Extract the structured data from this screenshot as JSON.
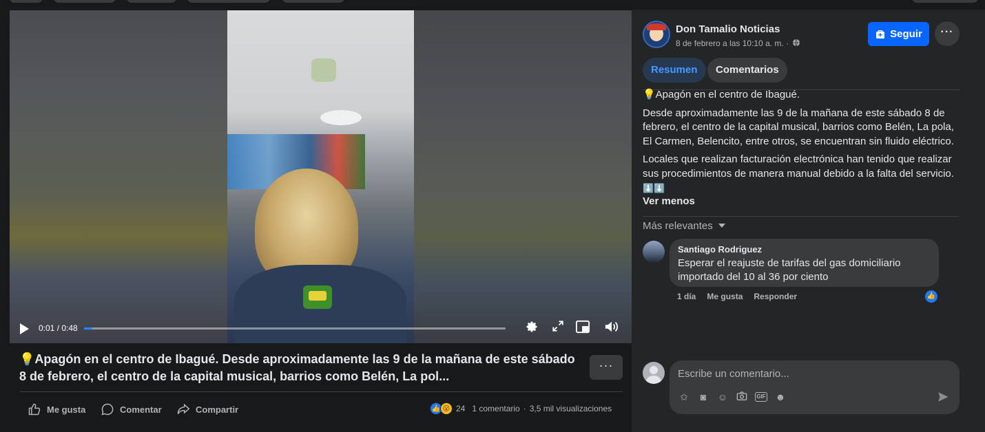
{
  "post": {
    "caption": "💡Apagón en el centro de Ibagué. Desde aproximadamente las 9 de la mañana de este sábado 8 de febrero, el centro de la capital musical, barrios como Belén, La pol...",
    "more_label": "···"
  },
  "video": {
    "time": "0:01 / 0:48",
    "progress": 0.02
  },
  "actions": {
    "like": "Me gusta",
    "comment": "Comentar",
    "share": "Compartir"
  },
  "stats": {
    "reactions": "24",
    "comments": "1 comentario",
    "separator": "·",
    "views": "3,5 mil visualizaciones"
  },
  "panel": {
    "page_name": "Don Tamalio Noticias",
    "date": "8 de febrero a las 10:10 a. m. ·",
    "follow": "Seguir",
    "tabs": [
      "Resumen",
      "Comentarios"
    ],
    "text_title": "💡Apagón en el centro de Ibagué.",
    "text_p1": "Desde aproximadamente las 9 de la mañana de este sábado 8 de febrero, el centro de la capital musical, barrios como Belén, La pola, El Carmen, Belencito, entre otros, se encuentran sin fluido eléctrico.",
    "text_p2": "Locales que realizan facturación electrónica han tenido que realizar sus procedimientos de manera manual debido a la falta del servicio.",
    "text_p3": "⬇️⬇️",
    "see_less": "Ver menos",
    "sort": "Más relevantes"
  },
  "comment": {
    "author": "Santiago Rodriguez",
    "text": "Esperar el reajuste de tarifas del gas domiciliario importado del 10 al 36 por ciento",
    "time": "1 día",
    "like": "Me gusta",
    "reply": "Responder"
  },
  "composer": {
    "placeholder": "Escribe un comentario..."
  },
  "colors": {
    "accent": "#0866ff",
    "tab_active_bg": "#263951",
    "tab_active_fg": "#4599ff",
    "panel_bg": "#242526",
    "page_bg": "#18191a"
  }
}
